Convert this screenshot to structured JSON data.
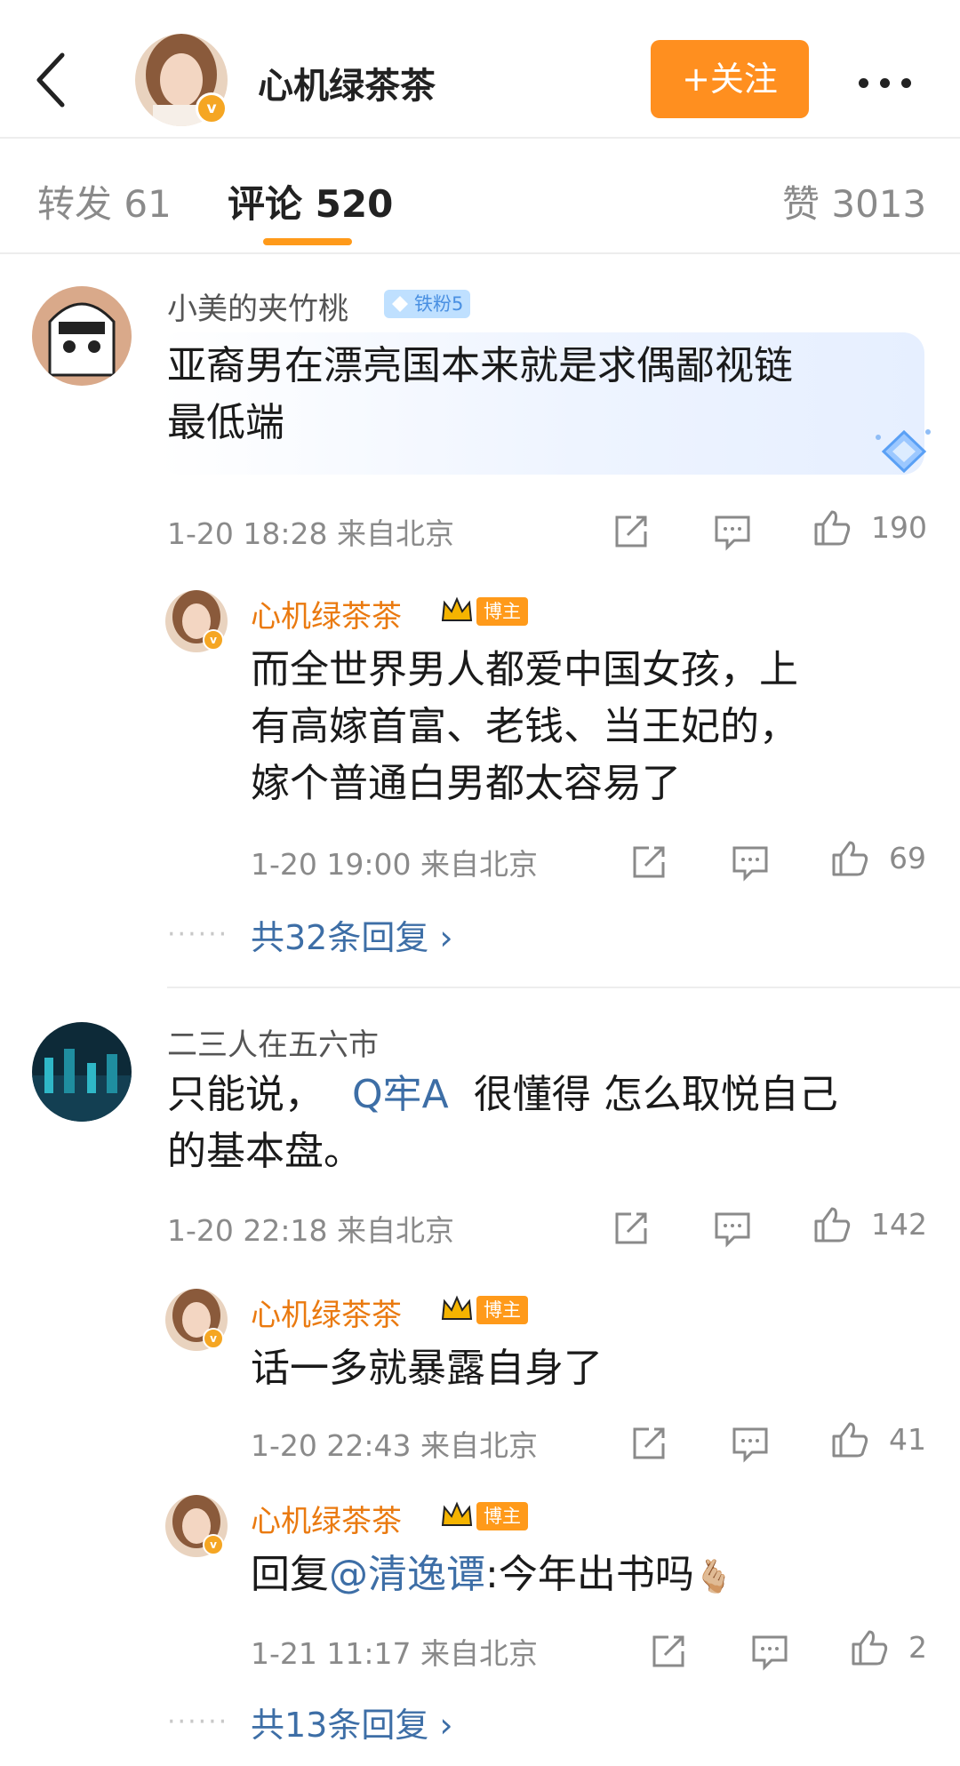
{
  "header": {
    "username": "心机绿茶茶",
    "follow_label": "+关注"
  },
  "tabs": [
    {
      "label": "转发 61"
    },
    {
      "label": "评论 520"
    },
    {
      "label": "赞 3013"
    }
  ],
  "comments": [
    {
      "username": "小美的夹竹桃",
      "badge": "铁粉5",
      "text_line1": "亚裔男在漂亮国本来就是求偶鄙视链",
      "text_line2": "最低端",
      "time": "1-20 18:28 来自北京",
      "likes": "190",
      "replies": [
        {
          "username": "心机绿茶茶",
          "badge": "博主",
          "text_line1": "而全世界男人都爱中国女孩，上",
          "text_line2": "有高嫁首富、老钱、当王妃的，",
          "text_line3": "嫁个普通白男都太容易了",
          "time": "1-20 19:00 来自北京",
          "likes": "69"
        }
      ],
      "more_replies": "共32条回复 ›"
    },
    {
      "username": "二三人在五六市",
      "text_pre": "只能说，",
      "text_link": "Q牢A",
      "text_post": "很懂得 怎么取悦自己",
      "text_line2": "的基本盘。",
      "time": "1-20 22:18 来自北京",
      "likes": "142",
      "replies": [
        {
          "username": "心机绿茶茶",
          "badge": "博主",
          "text": "话一多就暴露自身了",
          "time": "1-20 22:43 来自北京",
          "likes": "41"
        },
        {
          "username": "心机绿茶茶",
          "badge": "博主",
          "text_pre": "回复",
          "text_mention": "@清逸谭",
          "text_post": ":今年出书吗",
          "emoji": "🫰🏼",
          "time": "1-21 11:17 来自北京",
          "likes": "2"
        }
      ],
      "more_replies": "共13条回复 ›"
    }
  ],
  "colors": {
    "accent": "#ff8f1f",
    "link": "#3d6ea6",
    "op_name": "#ea7a10",
    "meta": "#8a8a8a"
  }
}
